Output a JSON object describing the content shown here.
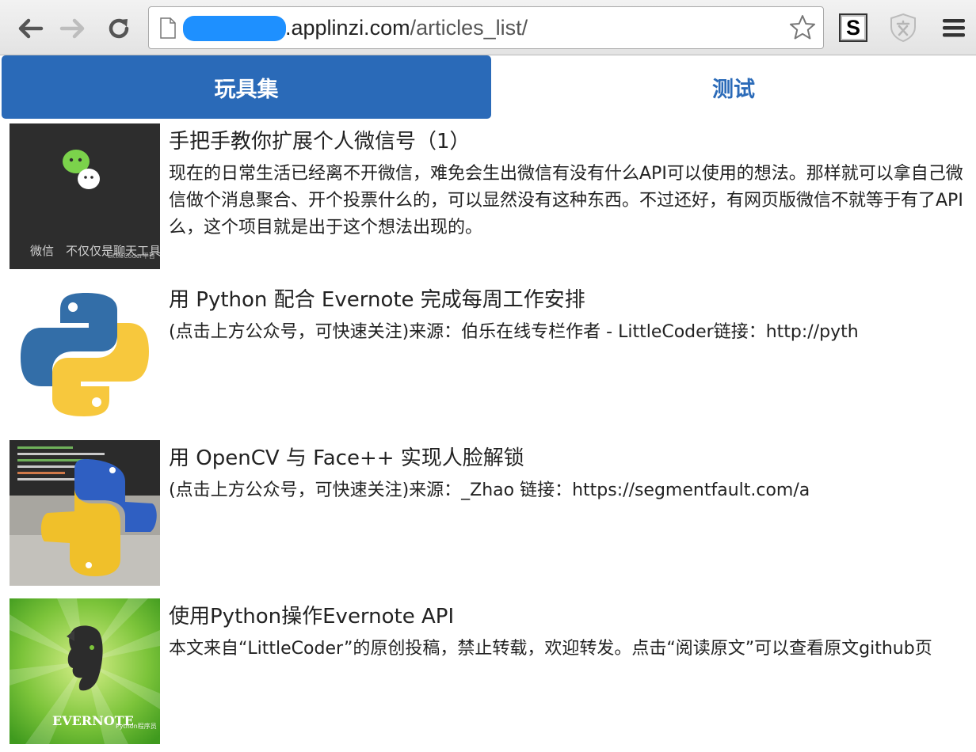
{
  "browser": {
    "url_domain": ".applinzi.com",
    "url_path": "/articles_list/",
    "extension_s_label": "S"
  },
  "tabs": [
    {
      "label": "玩具集",
      "active": true
    },
    {
      "label": "测试",
      "active": false
    }
  ],
  "articles": [
    {
      "title": "手把手教你扩展个人微信号（1）",
      "description": "现在的日常生活已经离不开微信，难免会生出微信有没有什么API可以使用的想法。那样就可以拿自己微信做个消息聚合、开个投票什么的，可以显然没有这种东西。不过还好，有网页版微信不就等于有了API么，这个项目就是出于这个想法出现的。",
      "thumb_caption": "微信　不仅仅是聊天工具",
      "thumb_watermark": "LittleCoder平台"
    },
    {
      "title": "用 Python 配合 Evernote 完成每周工作安排",
      "description": "(点击上方公众号，可快速关注)来源：伯乐在线专栏作者 - LittleCoder链接：http://pyth"
    },
    {
      "title": "用 OpenCV 与 Face++ 实现人脸解锁",
      "description": "(点击上方公众号，可快速关注)来源：_Zhao  链接：https://segmentfault.com/a"
    },
    {
      "title": "使用Python操作Evernote API",
      "description": "本文来自“LittleCoder”的原创投稿，禁止转载，欢迎转发。点击“阅读原文”可以查看原文github页",
      "thumb_caption": "EVERNOTE",
      "thumb_watermark": "Python程序员"
    }
  ],
  "colors": {
    "accent": "#2a6ab8",
    "url_mask": "#1e90ff"
  }
}
